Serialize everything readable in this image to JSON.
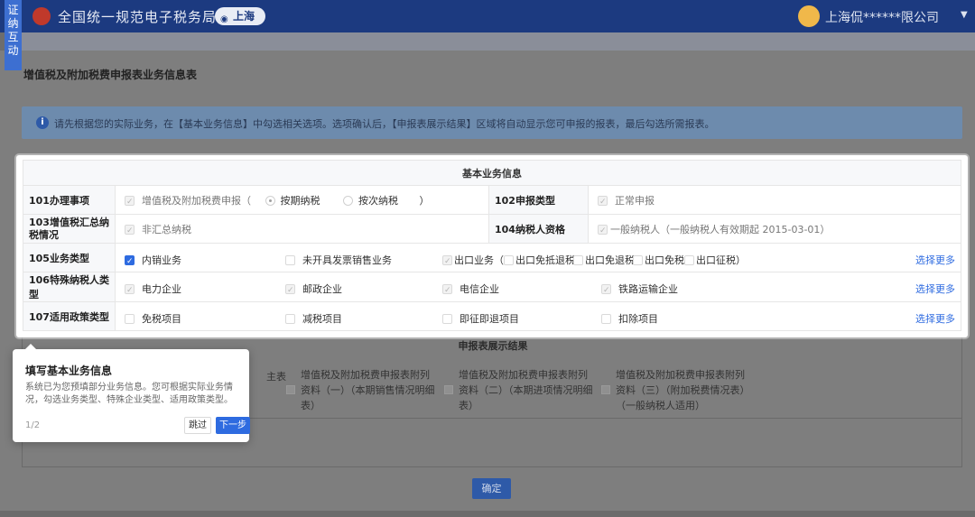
{
  "header": {
    "app_title": "全国统一规范电子税务局",
    "region": "上海",
    "company": "上海侃******限公司"
  },
  "side_tab": "证纳互动",
  "page": {
    "title": "增值税及附加税费申报表业务信息表",
    "notice": "请先根据您的实际业务，在【基本业务信息】中勾选相关选项。选项确认后，【申报表展示结果】区域将自动显示您可申报的报表，最后勾选所需报表。"
  },
  "basic_info": {
    "section_title": "基本业务信息",
    "row101": {
      "label": "101办理事项",
      "value": "增值税及附加税费申报（",
      "radio1": "按期纳税",
      "radio2": "按次纳税",
      "close": "）"
    },
    "row102": {
      "label": "102申报类型",
      "value": "正常申报"
    },
    "row103": {
      "label": "103增值税汇总纳税情况",
      "value": "非汇总纳税"
    },
    "row104": {
      "label": "104纳税人资格",
      "value": "一般纳税人（一般纳税人有效期起 2015-03-01）"
    },
    "row105": {
      "label": "105业务类型",
      "opt1": "内销业务",
      "opt2": "未开具发票销售业务",
      "opt3": "出口业务（",
      "opt4": "出口免抵退税",
      "opt5": "出口免退税",
      "opt6": "出口免税",
      "opt7": "出口征税）",
      "more": "选择更多"
    },
    "row106": {
      "label": "106特殊纳税人类型",
      "opt1": "电力企业",
      "opt2": "邮政企业",
      "opt3": "电信企业",
      "opt4": "铁路运输企业",
      "more": "选择更多"
    },
    "row107": {
      "label": "107适用政策类型",
      "opt1": "免税项目",
      "opt2": "减税项目",
      "opt3": "即征即退项目",
      "opt4": "扣除项目",
      "more": "选择更多"
    }
  },
  "results": {
    "section_title": "申报表展示结果",
    "stub": "主表",
    "col1": [
      "增值税及附加税费申报表附列",
      "资料（一）（本期销售情况明细",
      "表）"
    ],
    "col2": [
      "增值税及附加税费申报表附列",
      "资料（二）（本期进项情况明细",
      "表）"
    ],
    "col3": [
      "增值税及附加税费申报表附列",
      "资料（三）（附加税费情况表）",
      "（一般纳税人适用）"
    ]
  },
  "confirm_label": "确定",
  "guide": {
    "title": "填写基本业务信息",
    "text": "系统已为您预填部分业务信息。您可根据实际业务情况，勾选业务类型、特殊企业类型、适用政策类型。",
    "step": "1/2",
    "skip": "跳过",
    "next": "下一步"
  }
}
